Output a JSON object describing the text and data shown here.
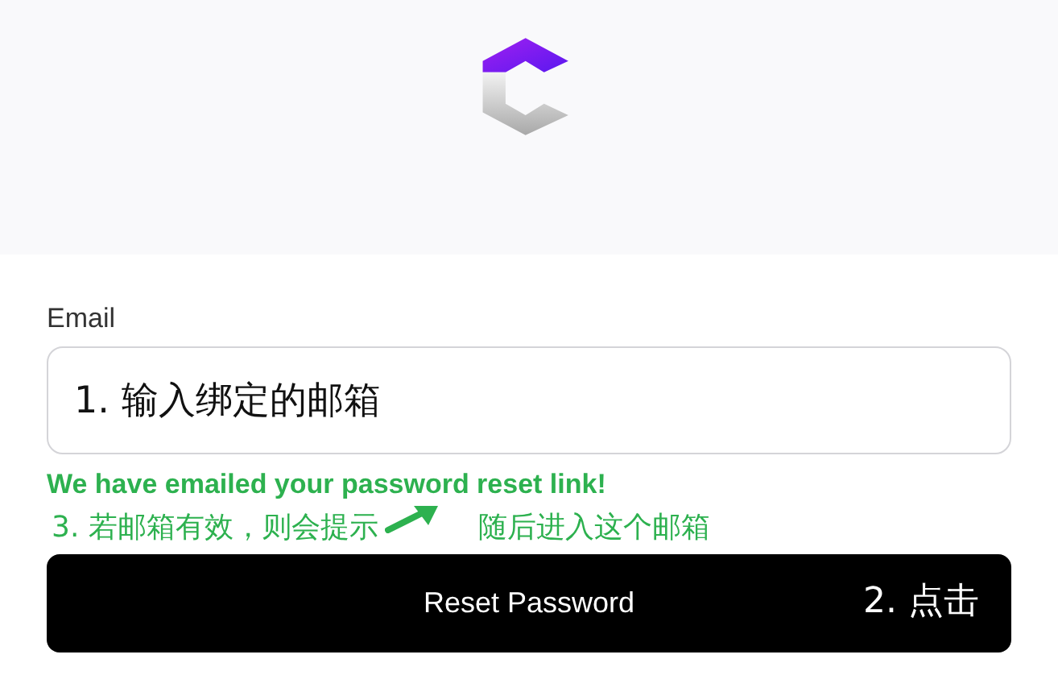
{
  "email": {
    "label": "Email",
    "value": "1. 输入绑定的邮箱"
  },
  "status_message": "We have emailed your password reset link!",
  "annotations": [
    {
      "text": "3. 若邮箱有效，则会提示"
    },
    {
      "text": "随后进入这个邮箱"
    }
  ],
  "button": {
    "label": "Reset Password",
    "annotation": "2. 点击"
  }
}
